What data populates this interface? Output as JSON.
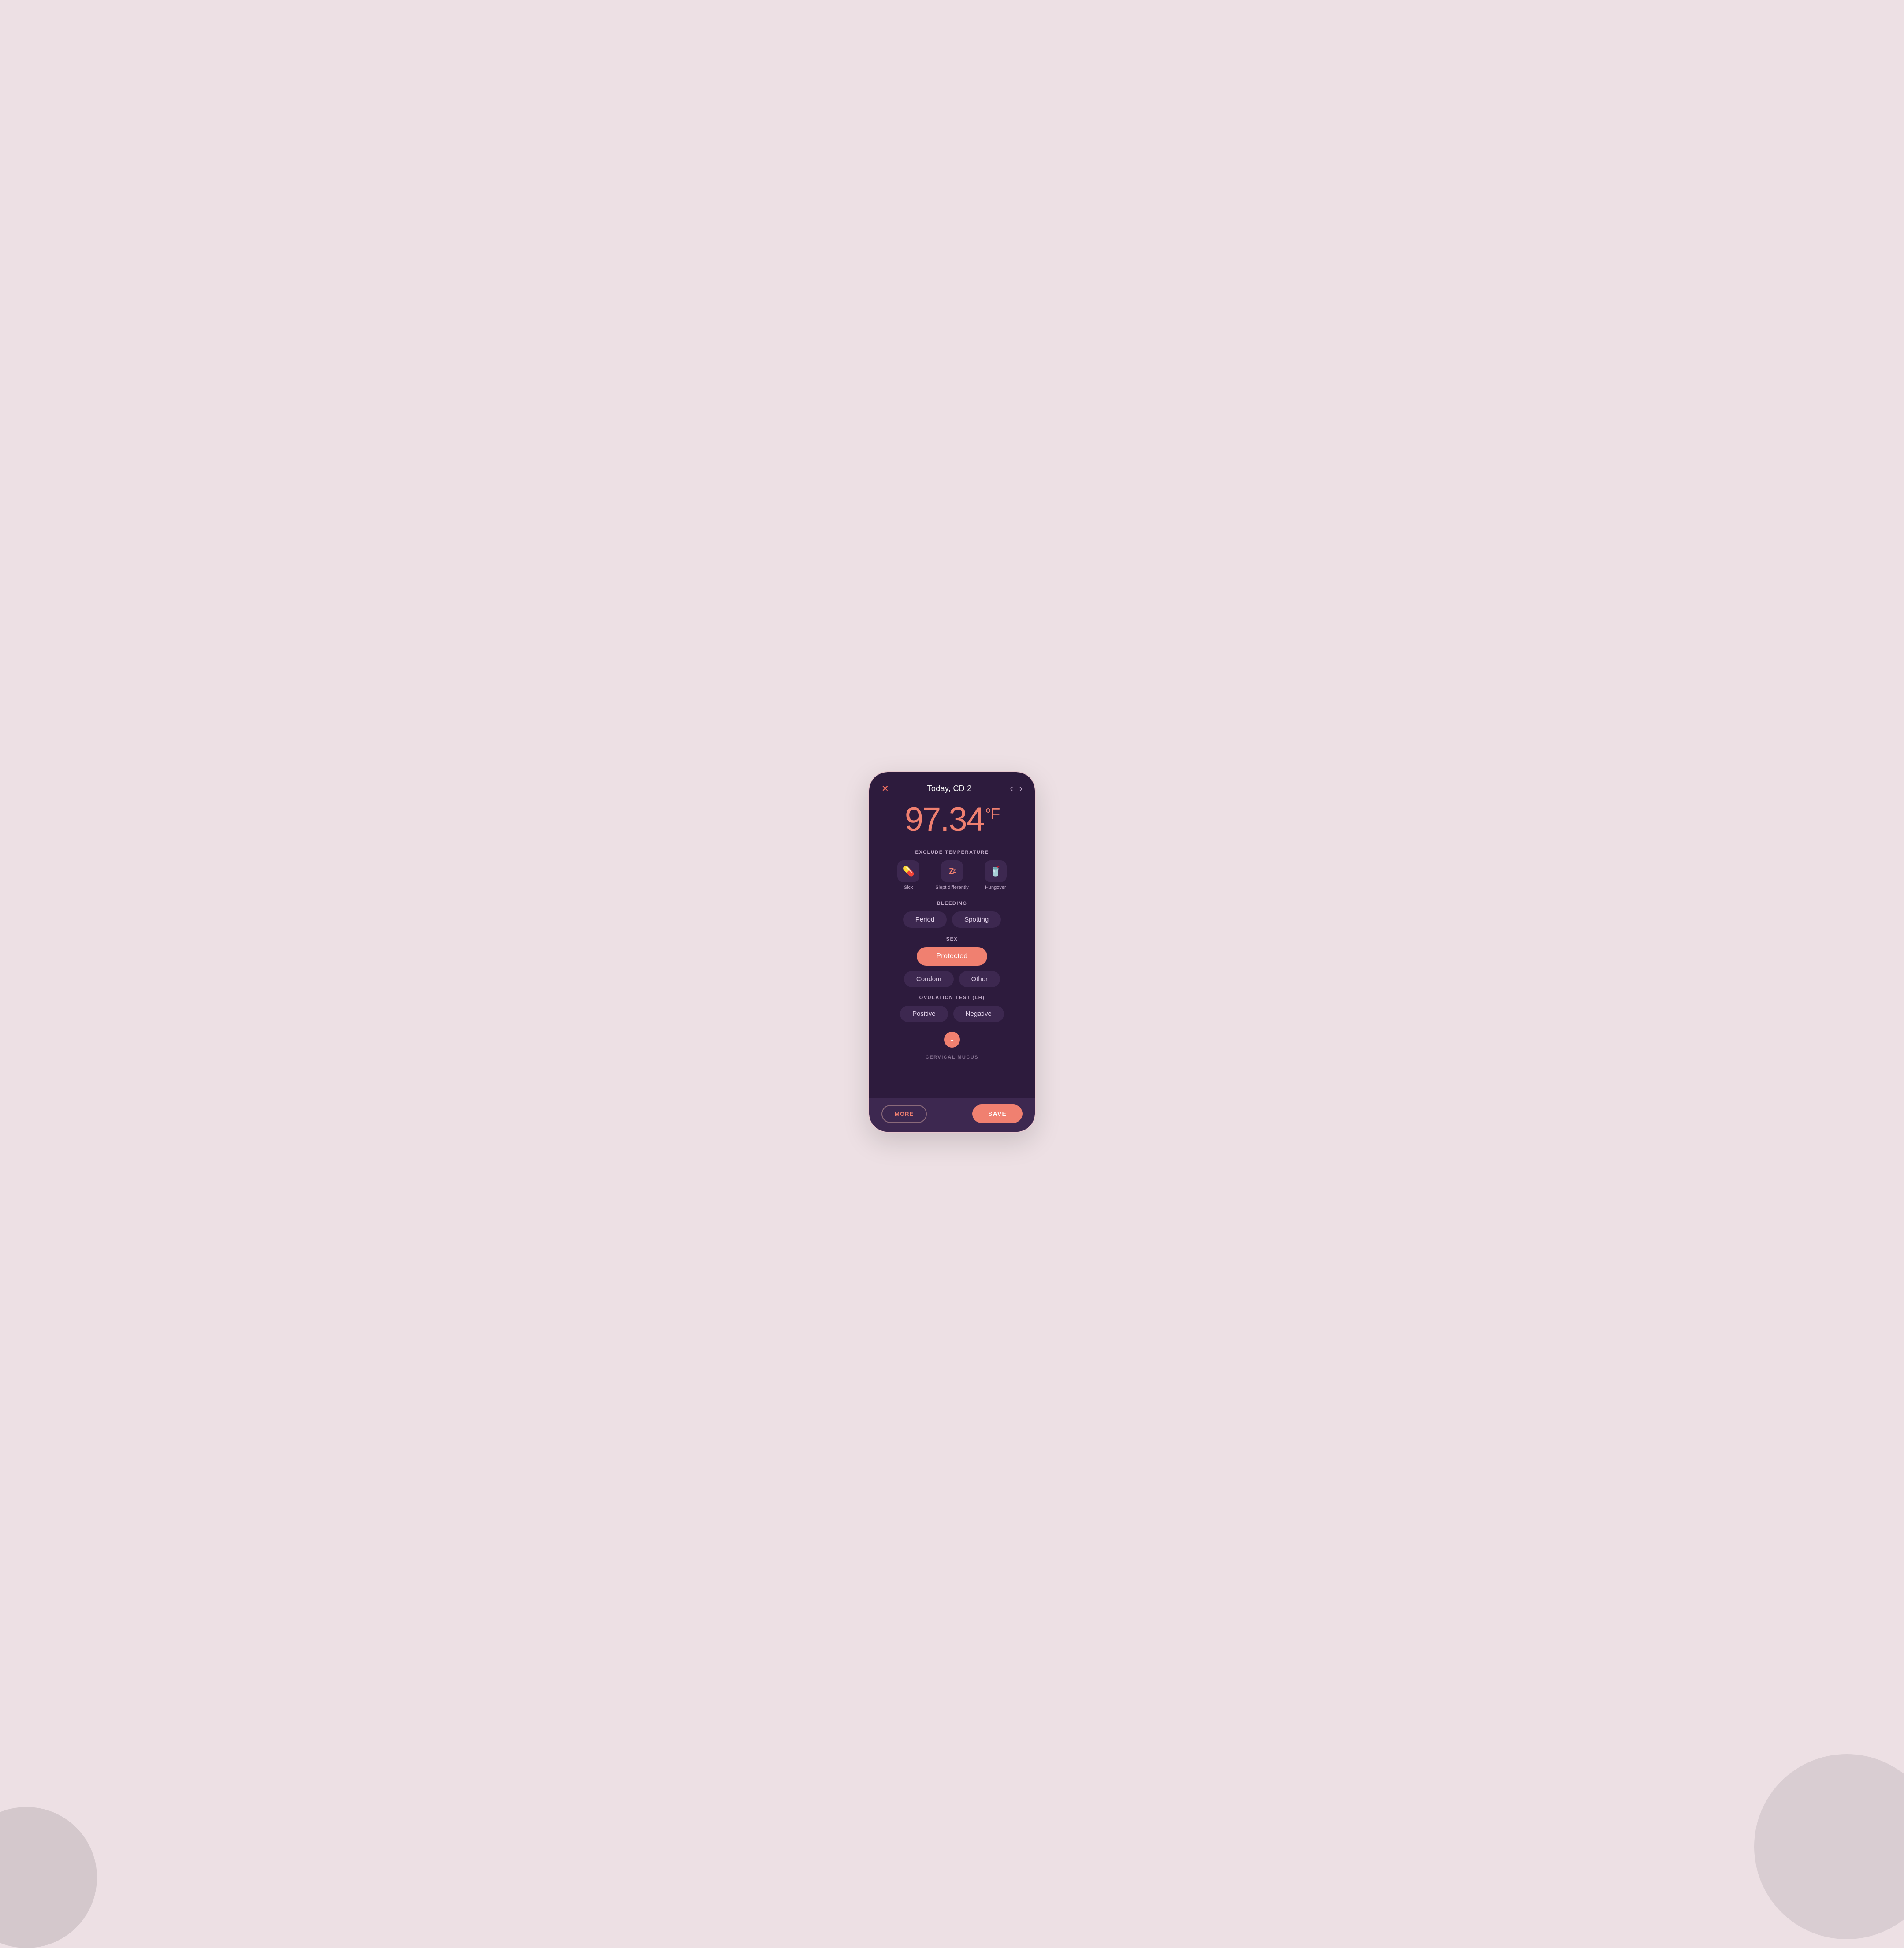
{
  "background": {
    "color": "#ede0e4"
  },
  "header": {
    "close_label": "✕",
    "title": "Today, CD 2",
    "nav_left": "‹",
    "nav_right": "›"
  },
  "temperature": {
    "value": "97.34",
    "unit": "°F"
  },
  "exclude_temperature": {
    "section_title": "EXCLUDE TEMPERATURE",
    "items": [
      {
        "id": "sick",
        "icon": "💊",
        "label": "Sick"
      },
      {
        "id": "slept",
        "icon": "💤",
        "label": "Slept differently"
      },
      {
        "id": "hungover",
        "icon": "🥤",
        "label": "Hungover"
      }
    ]
  },
  "bleeding": {
    "section_title": "BLEEDING",
    "buttons": [
      {
        "id": "period",
        "label": "Period",
        "active": false
      },
      {
        "id": "spotting",
        "label": "Spotting",
        "active": false
      }
    ]
  },
  "sex": {
    "section_title": "SEX",
    "protected_label": "Protected",
    "sub_buttons": [
      {
        "id": "condom",
        "label": "Condom",
        "active": false
      },
      {
        "id": "other",
        "label": "Other",
        "active": false
      }
    ]
  },
  "ovulation": {
    "section_title": "OVULATION TEST (LH)",
    "buttons": [
      {
        "id": "positive",
        "label": "Positive",
        "active": false
      },
      {
        "id": "negative",
        "label": "Negative",
        "active": false
      }
    ]
  },
  "scroll": {
    "icon": "⌄"
  },
  "cervical_mucus": {
    "section_title": "CERVICAL MUCUS"
  },
  "footer": {
    "more_label": "MORE",
    "save_label": "SAVE"
  }
}
